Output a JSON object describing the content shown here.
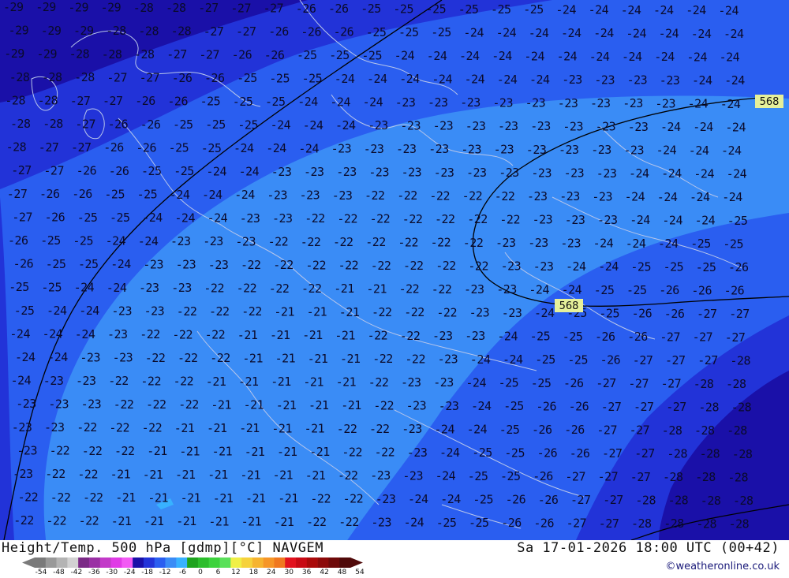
{
  "map": {
    "highlighted_contour_label": "568",
    "isotherm_grid": [
      [
        "-29",
        "-29",
        "-29",
        "-29",
        "-28",
        "-28",
        "-27",
        "-27",
        "-27",
        "-26",
        "-26",
        "-25",
        "-25",
        "-25",
        "-25",
        "-25",
        "-25",
        "-24",
        "-24",
        "-24",
        "-24",
        "-24",
        "-24"
      ],
      [
        "-29",
        "-29",
        "-29",
        "-28",
        "-28",
        "-28",
        "-27",
        "-27",
        "-26",
        "-26",
        "-26",
        "-25",
        "-25",
        "-25",
        "-24",
        "-24",
        "-24",
        "-24",
        "-24",
        "-24",
        "-24",
        "-24",
        "-24"
      ],
      [
        "-29",
        "-29",
        "-28",
        "-28",
        "-28",
        "-27",
        "-27",
        "-26",
        "-26",
        "-25",
        "-25",
        "-25",
        "-24",
        "-24",
        "-24",
        "-24",
        "-24",
        "-24",
        "-24",
        "-24",
        "-24",
        "-24",
        "-24"
      ],
      [
        "-28",
        "-28",
        "-28",
        "-27",
        "-27",
        "-26",
        "-26",
        "-25",
        "-25",
        "-25",
        "-24",
        "-24",
        "-24",
        "-24",
        "-24",
        "-24",
        "-24",
        "-23",
        "-23",
        "-23",
        "-23",
        "-24",
        "-24"
      ],
      [
        "-28",
        "-28",
        "-27",
        "-27",
        "-26",
        "-26",
        "-25",
        "-25",
        "-25",
        "-24",
        "-24",
        "-24",
        "-23",
        "-23",
        "-23",
        "-23",
        "-23",
        "-23",
        "-23",
        "-23",
        "-23",
        "-24",
        "-24"
      ],
      [
        "-28",
        "-28",
        "-27",
        "-26",
        "-26",
        "-25",
        "-25",
        "-25",
        "-24",
        "-24",
        "-24",
        "-23",
        "-23",
        "-23",
        "-23",
        "-23",
        "-23",
        "-23",
        "-23",
        "-23",
        "-24",
        "-24",
        "-24"
      ],
      [
        "-28",
        "-27",
        "-27",
        "-26",
        "-26",
        "-25",
        "-25",
        "-24",
        "-24",
        "-24",
        "-23",
        "-23",
        "-23",
        "-23",
        "-23",
        "-23",
        "-23",
        "-23",
        "-23",
        "-23",
        "-24",
        "-24",
        "-24"
      ],
      [
        "-27",
        "-27",
        "-26",
        "-26",
        "-25",
        "-25",
        "-24",
        "-24",
        "-23",
        "-23",
        "-23",
        "-23",
        "-23",
        "-23",
        "-23",
        "-23",
        "-23",
        "-23",
        "-23",
        "-24",
        "-24",
        "-24",
        "-24"
      ],
      [
        "-27",
        "-26",
        "-26",
        "-25",
        "-25",
        "-24",
        "-24",
        "-24",
        "-23",
        "-23",
        "-23",
        "-22",
        "-22",
        "-22",
        "-22",
        "-22",
        "-23",
        "-23",
        "-23",
        "-24",
        "-24",
        "-24",
        "-24"
      ],
      [
        "-27",
        "-26",
        "-25",
        "-25",
        "-24",
        "-24",
        "-24",
        "-23",
        "-23",
        "-22",
        "-22",
        "-22",
        "-22",
        "-22",
        "-22",
        "-22",
        "-23",
        "-23",
        "-23",
        "-24",
        "-24",
        "-24",
        "-25"
      ],
      [
        "-26",
        "-25",
        "-25",
        "-24",
        "-24",
        "-23",
        "-23",
        "-23",
        "-22",
        "-22",
        "-22",
        "-22",
        "-22",
        "-22",
        "-22",
        "-23",
        "-23",
        "-23",
        "-24",
        "-24",
        "-24",
        "-25",
        "-25"
      ],
      [
        "-26",
        "-25",
        "-25",
        "-24",
        "-23",
        "-23",
        "-23",
        "-22",
        "-22",
        "-22",
        "-22",
        "-22",
        "-22",
        "-22",
        "-22",
        "-23",
        "-23",
        "-24",
        "-24",
        "-25",
        "-25",
        "-25",
        "-26"
      ],
      [
        "-25",
        "-25",
        "-24",
        "-24",
        "-23",
        "-23",
        "-22",
        "-22",
        "-22",
        "-22",
        "-21",
        "-21",
        "-22",
        "-22",
        "-23",
        "-23",
        "-24",
        "-24",
        "-25",
        "-25",
        "-26",
        "-26",
        "-26"
      ],
      [
        "-25",
        "-24",
        "-24",
        "-23",
        "-23",
        "-22",
        "-22",
        "-22",
        "-21",
        "-21",
        "-21",
        "-22",
        "-22",
        "-22",
        "-23",
        "-23",
        "-24",
        "-25",
        "-25",
        "-26",
        "-26",
        "-27",
        "-27"
      ],
      [
        "-24",
        "-24",
        "-24",
        "-23",
        "-22",
        "-22",
        "-22",
        "-21",
        "-21",
        "-21",
        "-21",
        "-22",
        "-22",
        "-23",
        "-23",
        "-24",
        "-25",
        "-25",
        "-26",
        "-26",
        "-27",
        "-27",
        "-27"
      ],
      [
        "-24",
        "-24",
        "-23",
        "-23",
        "-22",
        "-22",
        "-22",
        "-21",
        "-21",
        "-21",
        "-21",
        "-22",
        "-22",
        "-23",
        "-24",
        "-24",
        "-25",
        "-25",
        "-26",
        "-27",
        "-27",
        "-27",
        "-28"
      ],
      [
        "-24",
        "-23",
        "-23",
        "-22",
        "-22",
        "-22",
        "-21",
        "-21",
        "-21",
        "-21",
        "-21",
        "-22",
        "-23",
        "-23",
        "-24",
        "-25",
        "-25",
        "-26",
        "-27",
        "-27",
        "-27",
        "-28",
        "-28"
      ],
      [
        "-23",
        "-23",
        "-23",
        "-22",
        "-22",
        "-22",
        "-21",
        "-21",
        "-21",
        "-21",
        "-21",
        "-22",
        "-23",
        "-23",
        "-24",
        "-25",
        "-26",
        "-26",
        "-27",
        "-27",
        "-27",
        "-28",
        "-28"
      ],
      [
        "-23",
        "-23",
        "-22",
        "-22",
        "-22",
        "-21",
        "-21",
        "-21",
        "-21",
        "-21",
        "-22",
        "-22",
        "-23",
        "-24",
        "-24",
        "-25",
        "-26",
        "-26",
        "-27",
        "-27",
        "-28",
        "-28",
        "-28"
      ],
      [
        "-23",
        "-22",
        "-22",
        "-22",
        "-21",
        "-21",
        "-21",
        "-21",
        "-21",
        "-21",
        "-22",
        "-22",
        "-23",
        "-24",
        "-25",
        "-25",
        "-26",
        "-26",
        "-27",
        "-27",
        "-28",
        "-28",
        "-28"
      ],
      [
        "-23",
        "-22",
        "-22",
        "-21",
        "-21",
        "-21",
        "-21",
        "-21",
        "-21",
        "-21",
        "-22",
        "-23",
        "-23",
        "-24",
        "-25",
        "-25",
        "-26",
        "-27",
        "-27",
        "-27",
        "-28",
        "-28",
        "-28"
      ],
      [
        "-22",
        "-22",
        "-22",
        "-21",
        "-21",
        "-21",
        "-21",
        "-21",
        "-21",
        "-22",
        "-22",
        "-23",
        "-24",
        "-24",
        "-25",
        "-26",
        "-26",
        "-27",
        "-27",
        "-28",
        "-28",
        "-28",
        "-28"
      ],
      [
        "-22",
        "-22",
        "-22",
        "-21",
        "-21",
        "-21",
        "-21",
        "-21",
        "-21",
        "-22",
        "-22",
        "-23",
        "-24",
        "-25",
        "-25",
        "-26",
        "-26",
        "-27",
        "-27",
        "-28",
        "-28",
        "-28",
        "-28"
      ]
    ],
    "colors": {
      "band_minus_29": "#1a10a8",
      "band_minus_27": "#2233d8",
      "band_minus_25": "#2a5ef0",
      "band_minus_23": "#3a8cf6",
      "land_outline": "#b8c6ea",
      "contour_line": "#000000",
      "highlight_box": "#e6f09a"
    }
  },
  "footer": {
    "title_left": "Height/Temp. 500 hPa [gdmp][°C] NAVGEM",
    "title_right": "Sa 17-01-2026 18:00 UTC (00+42)",
    "credit": "©weatheronline.co.uk",
    "scale_ticks": [
      "-54",
      "-48",
      "-42",
      "-36",
      "-30",
      "-24",
      "-18",
      "-12",
      "-6",
      "0",
      "6",
      "12",
      "18",
      "24",
      "30",
      "36",
      "42",
      "48",
      "54"
    ],
    "scale_colors": [
      "#7a7a7a",
      "#999999",
      "#b4b4b4",
      "#d2d2d2",
      "#7b2a86",
      "#9a30a4",
      "#c23ac8",
      "#e03ce6",
      "#f25af4",
      "#1a10a8",
      "#2233d8",
      "#2a5ef0",
      "#3a8cf6",
      "#38b2ff",
      "#1ea31e",
      "#2cbd2c",
      "#3cd23c",
      "#5ae05a",
      "#f0f046",
      "#f6d23c",
      "#f6b430",
      "#f69628",
      "#f07820",
      "#e2121e",
      "#c80a14",
      "#aa0a0a",
      "#8c0a0a",
      "#6e0a0a",
      "#500a0a"
    ]
  }
}
